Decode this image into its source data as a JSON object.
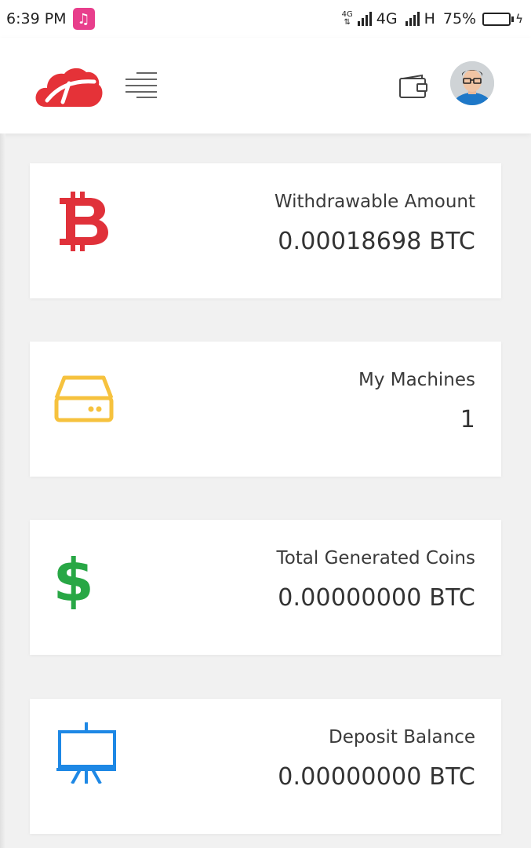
{
  "status_bar": {
    "time": "6:39 PM",
    "network_small": "4G",
    "network_main": "4G",
    "network_secondary": "H",
    "battery": "75%"
  },
  "header": {
    "logo_icon": "cloud-pickaxe-logo",
    "menu_icon": "hamburger-icon",
    "wallet_icon": "wallet-icon",
    "avatar_icon": "user-avatar"
  },
  "colors": {
    "brand_red": "#e53238",
    "bitcoin_red": "#e0313a",
    "machine_yellow": "#f6c23e",
    "dollar_green": "#28a745",
    "deposit_blue": "#1e88e5"
  },
  "cards": [
    {
      "icon": "bitcoin-icon",
      "label": "Withdrawable Amount",
      "value": "0.00018698 BTC"
    },
    {
      "icon": "hard-drive-icon",
      "label": "My Machines",
      "value": "1"
    },
    {
      "icon": "dollar-icon",
      "label": "Total Generated Coins",
      "value": "0.00000000 BTC"
    },
    {
      "icon": "presentation-board-icon",
      "label": "Deposit Balance",
      "value": "0.00000000 BTC"
    }
  ]
}
